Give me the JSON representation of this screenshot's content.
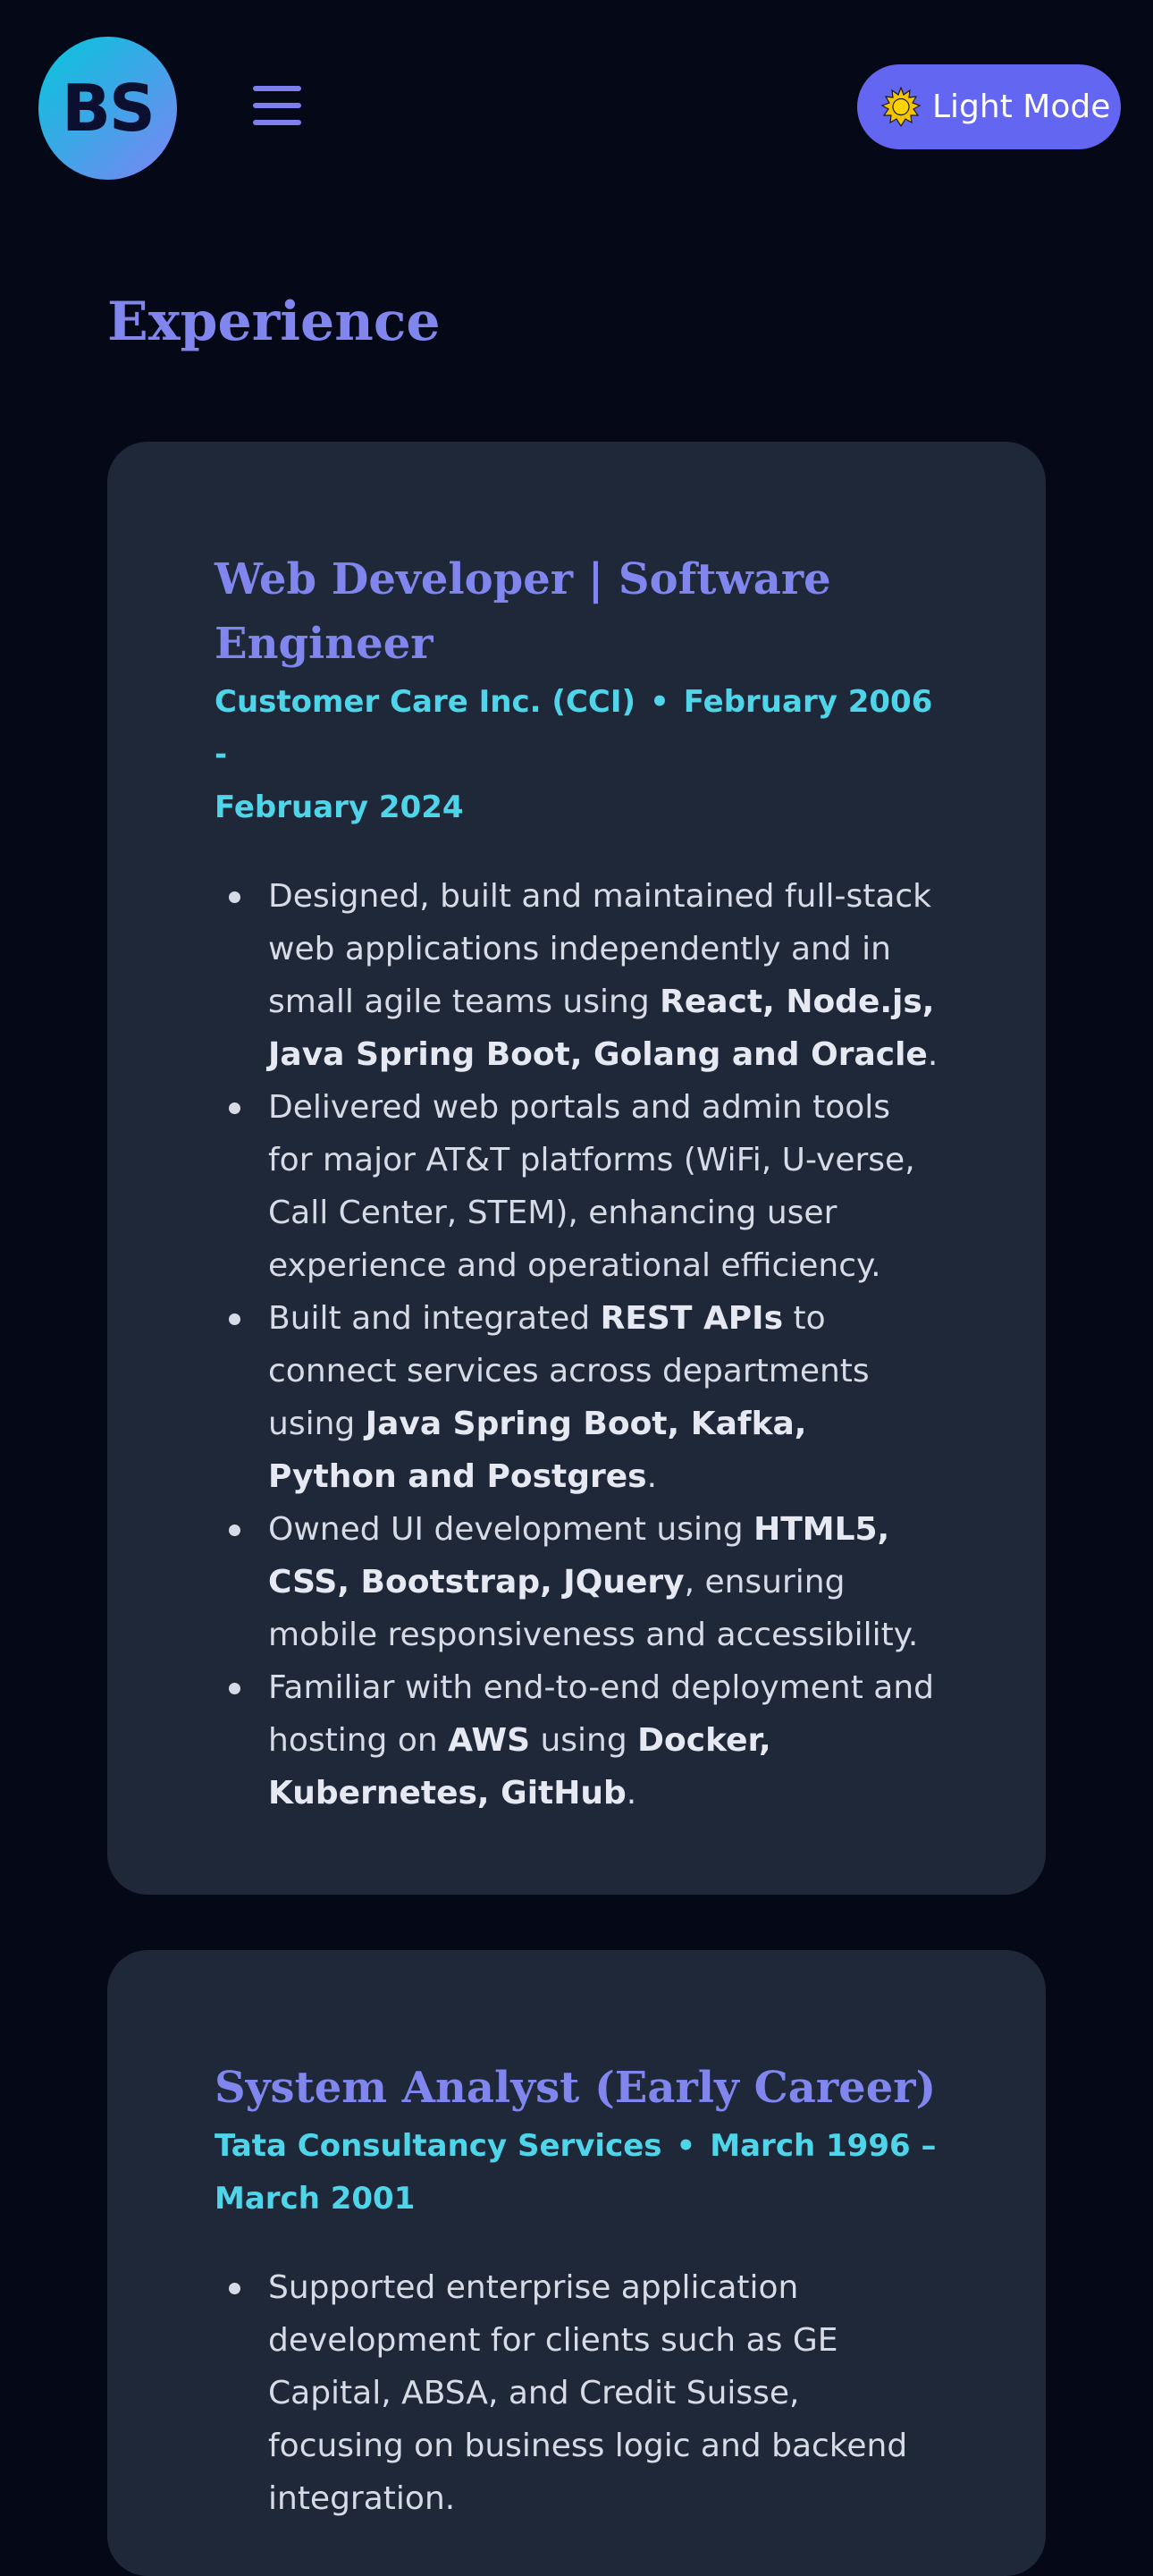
{
  "header": {
    "logo_text": "BS",
    "menu_icon": "hamburger-icon",
    "theme_toggle": {
      "icon": "sun-icon",
      "label": "Light Mode",
      "color": "#6366f1"
    }
  },
  "section": {
    "title": "Experience"
  },
  "experience": [
    {
      "title_line1": "Web Developer | Software",
      "title_line2": "Engineer",
      "company": "Customer Care Inc. (CCI)",
      "separator": "•",
      "dates_part1": "February 2006 -",
      "dates_part2": "February 2024",
      "duties": [
        {
          "text1": "Designed, built and maintained full-stack web applications independently and in small agile teams using ",
          "bold1": "React, Node.js, Java Spring Boot, Golang and Oracle",
          "text2": "."
        },
        {
          "text1": "Delivered web portals and admin tools for major AT&T platforms (WiFi, U-verse, Call Center, STEM), enhancing user experience and operational efficiency."
        },
        {
          "text1": "Built and integrated ",
          "bold1": "REST APIs",
          "text2": " to connect services across departments using ",
          "bold2": "Java Spring Boot, Kafka, Python and Postgres",
          "text3": "."
        },
        {
          "text1": "Owned UI development using ",
          "bold1": "HTML5, CSS, Bootstrap, JQuery",
          "text2": ", ensuring mobile responsiveness and accessibility."
        },
        {
          "text1": "Familiar with end-to-end deployment and hosting on ",
          "bold1": "AWS",
          "text2": " using ",
          "bold2": "Docker, Kubernetes, GitHub",
          "text3": "."
        }
      ]
    },
    {
      "title_line1": "System Analyst (Early Career)",
      "company": "Tata Consultancy Services",
      "separator": "•",
      "dates_part1": "March 1996 –",
      "dates_part2": "March 2001",
      "duties": [
        {
          "text1": "Supported enterprise application development for clients such as GE Capital, ABSA, and Credit Suisse, focusing on business logic and backend integration."
        }
      ]
    }
  ],
  "colors": {
    "background": "#050816",
    "card": "#1e2839",
    "heading": "#8086ee",
    "meta": "#4fd5ea",
    "body_text": "#d7dbe6"
  }
}
